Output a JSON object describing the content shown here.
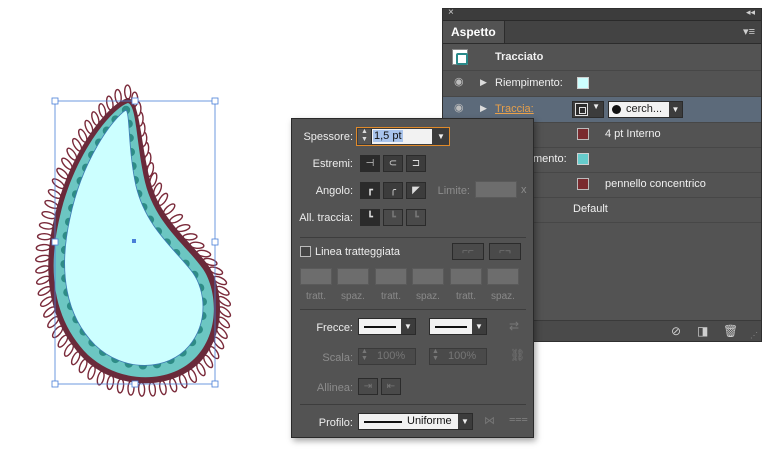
{
  "appearance": {
    "tab_label": "Aspetto",
    "object_label": "Tracciato",
    "rows": {
      "fill": {
        "label": "Riempimento:",
        "swatch": "#ccffff"
      },
      "stroke": {
        "label": "Traccia:",
        "brush": "cerch..."
      },
      "stroke_detail": {
        "value": "4 pt  Interno",
        "swatch": "#7a2a2e"
      },
      "fill2": {
        "label": "mento:",
        "swatch": "#66cccc"
      },
      "stroke2": {
        "value": "pennello concentrico",
        "swatch": "#7a2a2e"
      },
      "opacity": {
        "value": "Default"
      }
    },
    "icons": [
      "eye-icon",
      "no-icon",
      "duplicate-icon",
      "trash-icon"
    ]
  },
  "stroke_panel": {
    "weight_label": "Spessore:",
    "weight_value": "1,5 pt",
    "caps_label": "Estremi:",
    "corner_label": "Angolo:",
    "limit_label": "Limite:",
    "limit_unit": "x",
    "align_label": "All. traccia:",
    "dashed_label": "Linea tratteggiata",
    "dash_labels": [
      "tratt.",
      "spaz.",
      "tratt.",
      "spaz.",
      "tratt.",
      "spaz."
    ],
    "arrows_label": "Frecce:",
    "scale_label": "Scala:",
    "scale_left": "100%",
    "scale_right": "100%",
    "align_arrows_label": "Allinea:",
    "profile_label": "Profilo:",
    "profile_value": "Uniforme"
  },
  "colors": {
    "panel_bg": "#535353",
    "highlight_row": "#5c6a7a",
    "field_highlight": "#c8d8ee",
    "accent_orange": "#e08a2a",
    "paisley_outer": "#7a2a3a",
    "paisley_fill": "#ccffff",
    "paisley_band": "#66cccc",
    "selection_blue": "#4a7fd8"
  }
}
